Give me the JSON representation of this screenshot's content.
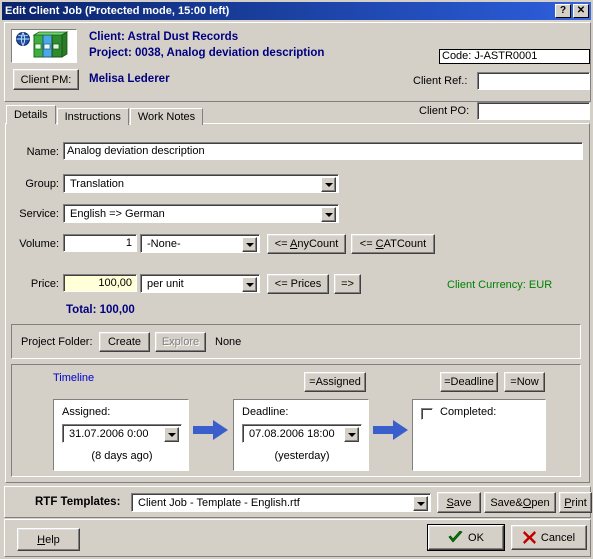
{
  "window": {
    "title": "Edit Client Job (Protected mode, 15:00 left)",
    "help_button": "?",
    "close_button": "✕"
  },
  "header": {
    "client_line": "Client: Astral Dust Records",
    "project_line": "Project: 0038, Analog deviation description",
    "client_pm_button": "Client PM:",
    "client_pm_name": "Melisa Lederer",
    "code_value": "Code: J-ASTR0001",
    "client_ref_label": "Client Ref.:",
    "client_ref_value": "",
    "client_po_label": "Client PO:",
    "client_po_value": ""
  },
  "tabs": [
    {
      "label": "Details",
      "active": true
    },
    {
      "label": "Instructions",
      "active": false
    },
    {
      "label": "Work Notes",
      "active": false
    }
  ],
  "details": {
    "name_label": "Name:",
    "name_value": "Analog deviation description",
    "group_label": "Group:",
    "group_value": "Translation",
    "service_label": "Service:",
    "service_value": "English => German",
    "volume_label": "Volume:",
    "volume_value": "1",
    "volume_unit_value": "-None-",
    "anycount_button": "<= AnyCount",
    "catcount_button": "<= CATCount",
    "price_label": "Price:",
    "price_value": "100,00",
    "price_unit_value": "per unit",
    "prices_button": "<= Prices",
    "arrow_button": "=>",
    "total_label": "Total: 100,00",
    "client_currency": "Client Currency: EUR"
  },
  "project_folder": {
    "label": "Project Folder:",
    "create_button": "Create",
    "explore_button": "Explore",
    "status": "None"
  },
  "timeline": {
    "title": "Timeline",
    "assigned_button": "=Assigned",
    "deadline_button": "=Deadline",
    "now_button": "=Now",
    "assigned_label": "Assigned:",
    "assigned_value": "31.07.2006 0:00",
    "assigned_note": "(8 days ago)",
    "deadline_label": "Deadline:",
    "deadline_value": "07.08.2006 18:00",
    "deadline_note": "(yesterday)",
    "completed_label": "Completed:",
    "completed_checked": false
  },
  "rtf": {
    "label": "RTF Templates:",
    "template_value": "Client Job - Template - English.rtf",
    "save_button": "Save",
    "save_open_button": "Save&Open",
    "print_button": "Print"
  },
  "footer": {
    "help_button": "Help",
    "ok_button": "OK",
    "cancel_button": "Cancel"
  },
  "colors": {
    "titlebar": "#0a246a",
    "face": "#d4d0c8",
    "accent_blue": "#000080",
    "link_blue": "#0000cc",
    "currency_green": "#008000",
    "price_field": "#ffffd8",
    "arrow_blue": "#3a5fcd"
  }
}
